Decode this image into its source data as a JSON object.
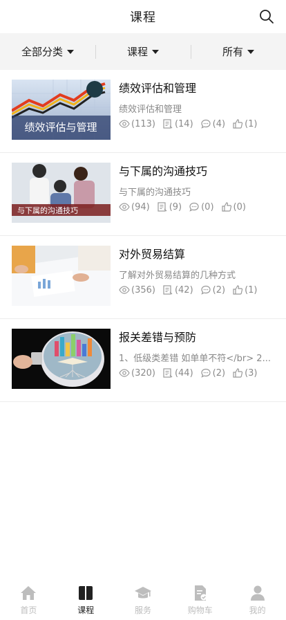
{
  "header": {
    "title": "课程"
  },
  "filters": [
    {
      "label": "全部分类"
    },
    {
      "label": "课程"
    },
    {
      "label": "所有"
    }
  ],
  "courses": [
    {
      "title": "绩效评估和管理",
      "desc": "绩效评估和管理",
      "views": "(113)",
      "lessons": "(14)",
      "comments": "(4)",
      "likes": "(1)",
      "thumb_text": "绩效评估与管理"
    },
    {
      "title": "与下属的沟通技巧",
      "desc": "与下属的沟通技巧",
      "views": "(94)",
      "lessons": "(9)",
      "comments": "(0)",
      "likes": "(0)",
      "thumb_text": "与下属的沟通技巧"
    },
    {
      "title": "对外贸易结算",
      "desc": "了解对外贸易结算的几种方式",
      "views": "(356)",
      "lessons": "(42)",
      "comments": "(2)",
      "likes": "(1)"
    },
    {
      "title": "报关差错与预防",
      "desc": "1、低级类差错 如单单不符</br> 2...",
      "views": "(320)",
      "lessons": "(44)",
      "comments": "(2)",
      "likes": "(3)"
    }
  ],
  "tabs": [
    {
      "label": "首页",
      "icon": "home-icon"
    },
    {
      "label": "课程",
      "icon": "book-icon",
      "active": true
    },
    {
      "label": "服务",
      "icon": "graduation-cap-icon"
    },
    {
      "label": "购物车",
      "icon": "cart-document-icon"
    },
    {
      "label": "我的",
      "icon": "user-icon"
    }
  ],
  "colors": {
    "active": "#222222",
    "inactive": "#bdbdbd",
    "filter_bg": "#f4f4f4"
  }
}
